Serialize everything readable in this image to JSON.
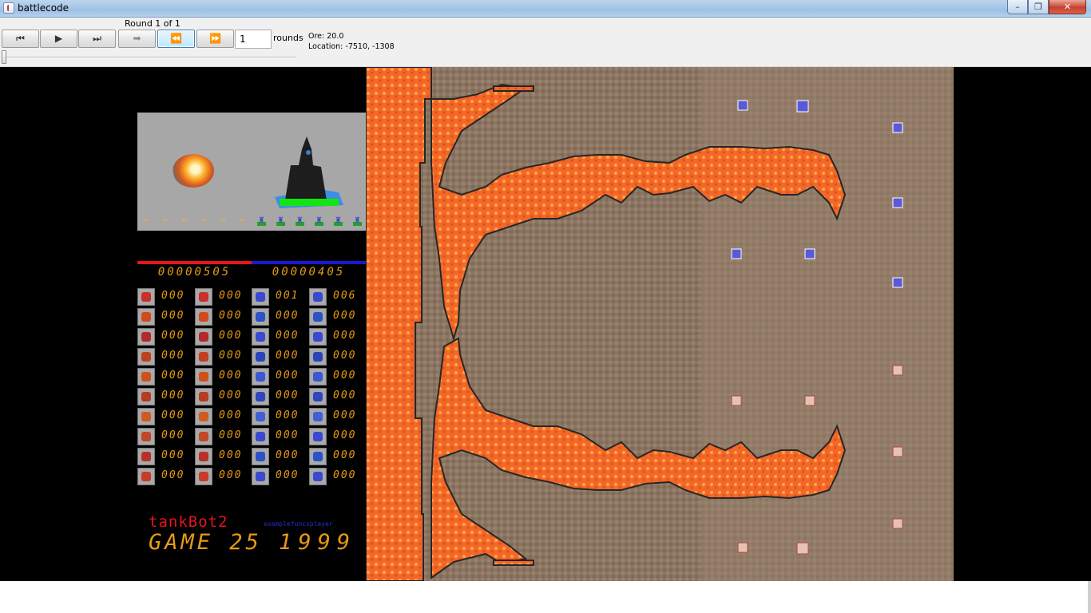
{
  "window": {
    "title": "battlecode",
    "minimize": "–",
    "maximize": "❐",
    "close": "✕"
  },
  "toolbar": {
    "round_label": "Round 1 of 1",
    "buttons": [
      {
        "label": "⏮",
        "name": "go-to-start-button"
      },
      {
        "label": "▶",
        "name": "play-button"
      },
      {
        "label": "⏭",
        "name": "go-to-end-button"
      },
      {
        "label": "➡",
        "name": "step-forward-button"
      },
      {
        "label": "⏪",
        "name": "rewind-button"
      },
      {
        "label": "⏩",
        "name": "fast-forward-button"
      }
    ],
    "round_input_value": "1",
    "rounds_label": "rounds",
    "ore_text": "Ore: 20.0",
    "location_text": "Location: -7510, -1308"
  },
  "scoreboard": {
    "red_score": "00000505",
    "blue_score": "00000405",
    "red_team_name": "tankBot2",
    "blue_team_name": "examplefuncsplayer",
    "game_label": "GAME 25",
    "year": "1999",
    "colors": {
      "red": "#e5141e",
      "blue": "#1a1ad2",
      "digits": "#e69a15"
    }
  },
  "unit_rows": [
    {
      "red_unit": "000",
      "red_struct": "000",
      "blue_unit": "001",
      "blue_struct": "006"
    },
    {
      "red_unit": "000",
      "red_struct": "000",
      "blue_unit": "000",
      "blue_struct": "000"
    },
    {
      "red_unit": "000",
      "red_struct": "000",
      "blue_unit": "000",
      "blue_struct": "000"
    },
    {
      "red_unit": "000",
      "red_struct": "000",
      "blue_unit": "000",
      "blue_struct": "000"
    },
    {
      "red_unit": "000",
      "red_struct": "000",
      "blue_unit": "000",
      "blue_struct": "000"
    },
    {
      "red_unit": "000",
      "red_struct": "000",
      "blue_unit": "000",
      "blue_struct": "000"
    },
    {
      "red_unit": "000",
      "red_struct": "000",
      "blue_unit": "000",
      "blue_struct": "000"
    },
    {
      "red_unit": "000",
      "red_struct": "000",
      "blue_unit": "000",
      "blue_struct": "000"
    },
    {
      "red_unit": "000",
      "red_struct": "000",
      "blue_unit": "000",
      "blue_struct": "000"
    },
    {
      "red_unit": "000",
      "red_struct": "000",
      "blue_unit": "000",
      "blue_struct": "000"
    }
  ],
  "unit_icons": [
    "beaver-icon",
    "miner-icon",
    "soldier-icon",
    "basher-icon",
    "drone-icon",
    "tank-icon",
    "commander-icon",
    "launcher-icon",
    "missile-icon",
    "computer-icon"
  ],
  "struct_icons": [
    "hq-icon",
    "supply-depot-icon",
    "miner-factory-icon",
    "barracks-icon",
    "helipad-icon",
    "tank-factory-icon",
    "technology-institute-icon",
    "training-field-icon",
    "aerospace-lab-icon",
    "handwash-station-icon"
  ]
}
